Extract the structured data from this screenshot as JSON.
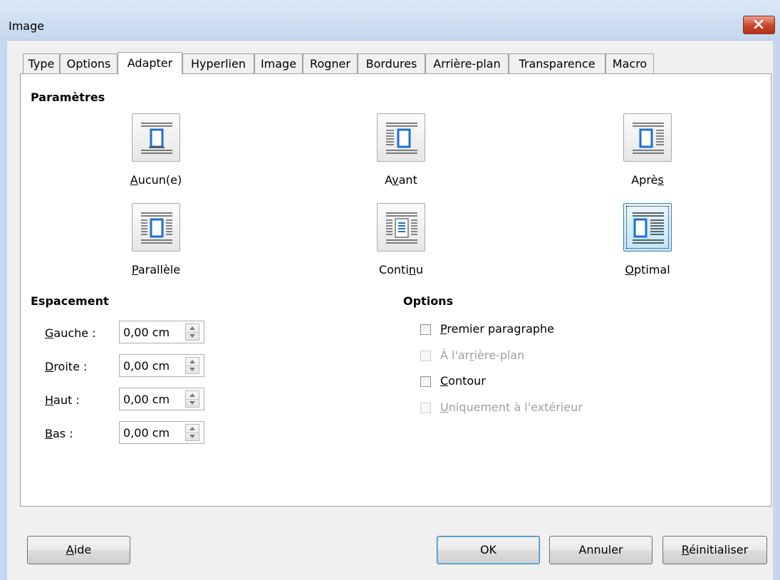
{
  "window": {
    "title": "Image"
  },
  "tabs": [
    "Type",
    "Options",
    "Adapter",
    "Hyperlien",
    "Image",
    "Rogner",
    "Bordures",
    "Arrière-plan",
    "Transparence",
    "Macro"
  ],
  "active_tab": "Adapter",
  "parametres": {
    "heading": "Paramètres",
    "options": [
      {
        "id": "aucun",
        "label": "Aucun(e)",
        "icon": "wrap-none-icon",
        "selected": false
      },
      {
        "id": "avant",
        "label": "Avant",
        "icon": "wrap-before-icon",
        "selected": false
      },
      {
        "id": "apres",
        "label": "Après",
        "icon": "wrap-after-icon",
        "selected": false
      },
      {
        "id": "parallele",
        "label": "Parallèle",
        "icon": "wrap-parallel-icon",
        "selected": false
      },
      {
        "id": "continu",
        "label": "Continu",
        "icon": "wrap-through-icon",
        "selected": false
      },
      {
        "id": "optimal",
        "label": "Optimal",
        "icon": "wrap-optimal-icon",
        "selected": true
      }
    ]
  },
  "espacement": {
    "heading": "Espacement",
    "fields": [
      {
        "label": "Gauche :",
        "value": "0,00 cm"
      },
      {
        "label": "Droite :",
        "value": "0,00 cm"
      },
      {
        "label": "Haut :",
        "value": "0,00 cm"
      },
      {
        "label": "Bas :",
        "value": "0,00 cm"
      }
    ]
  },
  "options": {
    "heading": "Options",
    "checkboxes": [
      {
        "label": "Premier paragraphe",
        "checked": false,
        "enabled": true
      },
      {
        "label": "À l'arrière-plan",
        "checked": false,
        "enabled": false
      },
      {
        "label": "Contour",
        "checked": false,
        "enabled": true
      },
      {
        "label": "Uniquement à l'extérieur",
        "checked": false,
        "enabled": false
      }
    ]
  },
  "buttons": {
    "help": "Aide",
    "ok": "OK",
    "cancel": "Annuler",
    "reset": "Réinitialiser"
  },
  "colors": {
    "accent": "#3c7fb1",
    "icon_blue": "#1f6fd0",
    "disabled_text": "#a0a0a0",
    "close": "#c8442a"
  }
}
